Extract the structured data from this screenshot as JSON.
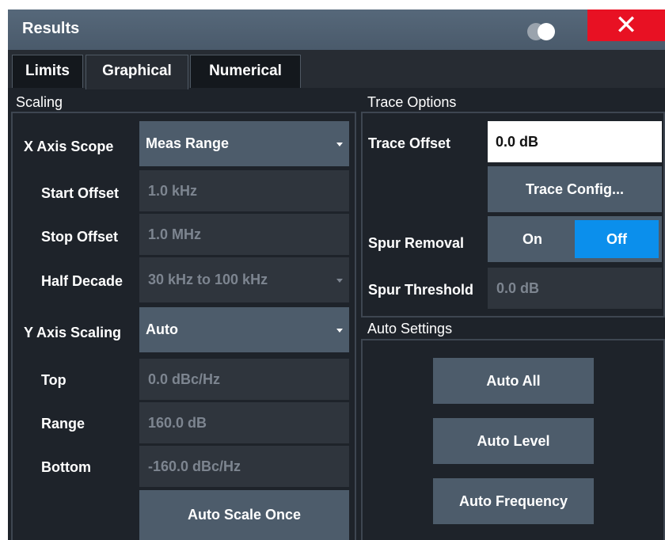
{
  "window": {
    "title": "Results"
  },
  "tabs": [
    {
      "label": "Limits"
    },
    {
      "label": "Graphical"
    },
    {
      "label": "Numerical"
    }
  ],
  "scaling": {
    "title": "Scaling",
    "x_axis_scope": {
      "label": "X Axis Scope",
      "value": "Meas Range"
    },
    "start_offset": {
      "label": "Start Offset",
      "value": "1.0 kHz"
    },
    "stop_offset": {
      "label": "Stop Offset",
      "value": "1.0 MHz"
    },
    "half_decade": {
      "label": "Half Decade",
      "value": "30 kHz to 100 kHz"
    },
    "y_axis_scaling": {
      "label": "Y Axis Scaling",
      "value": "Auto"
    },
    "top": {
      "label": "Top",
      "value": "0.0 dBc/Hz"
    },
    "range": {
      "label": "Range",
      "value": "160.0 dB"
    },
    "bottom": {
      "label": "Bottom",
      "value": "-160.0 dBc/Hz"
    },
    "auto_scale_once": "Auto Scale Once"
  },
  "trace_options": {
    "title": "Trace Options",
    "trace_offset": {
      "label": "Trace Offset",
      "value": "0.0 dB"
    },
    "trace_config": "Trace Config...",
    "spur_removal": {
      "label": "Spur Removal",
      "on": "On",
      "off": "Off",
      "selected": "Off"
    },
    "spur_threshold": {
      "label": "Spur Threshold",
      "value": "0.0 dB"
    }
  },
  "auto_settings": {
    "title": "Auto Settings",
    "auto_all": "Auto All",
    "auto_level": "Auto Level",
    "auto_frequency": "Auto Frequency"
  },
  "colors": {
    "background": "#1e232a",
    "button": "#4d5c6b",
    "accent_selected": "#0b8fec",
    "close": "#e81123"
  }
}
